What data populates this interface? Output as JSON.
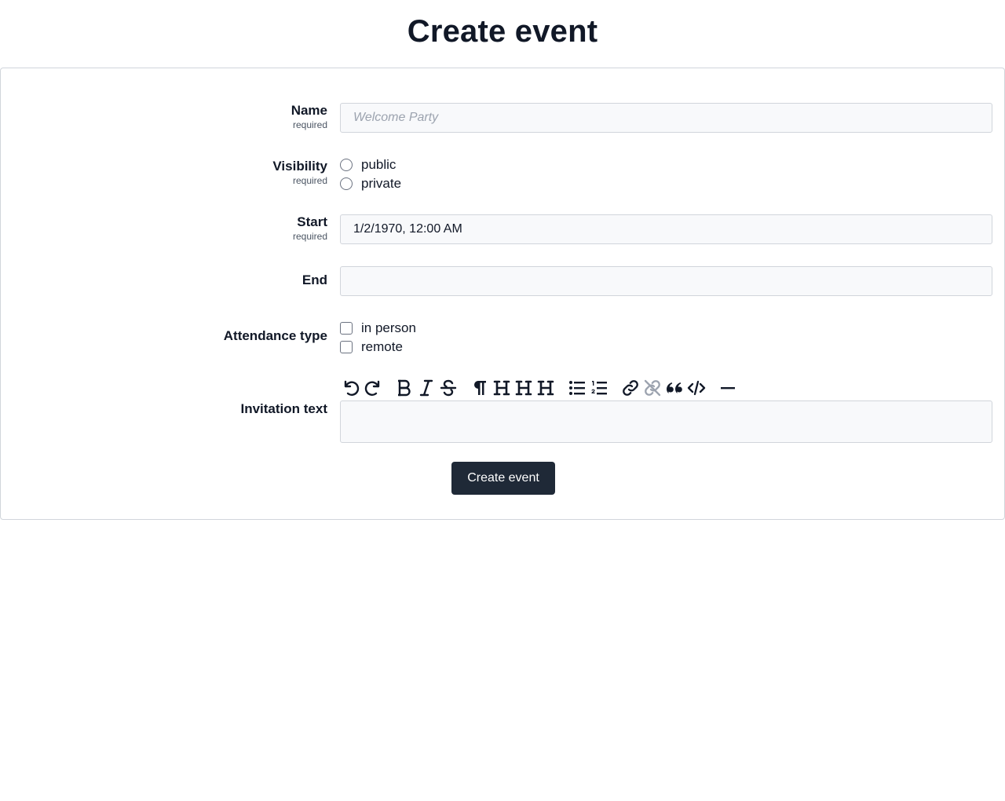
{
  "page": {
    "title": "Create event"
  },
  "form": {
    "name": {
      "label": "Name",
      "required_text": "required",
      "placeholder": "Welcome Party",
      "value": ""
    },
    "visibility": {
      "label": "Visibility",
      "required_text": "required",
      "options": [
        "public",
        "private"
      ]
    },
    "start": {
      "label": "Start",
      "required_text": "required",
      "value": "1/2/1970, 12:00 AM"
    },
    "end": {
      "label": "End",
      "value": ""
    },
    "attendance": {
      "label": "Attendance type",
      "options": [
        "in person",
        "remote"
      ]
    },
    "invitation": {
      "label": "Invitation text",
      "toolbar": [
        "undo-icon",
        "redo-icon",
        "bold-icon",
        "italic-icon",
        "strikethrough-icon",
        "paragraph-icon",
        "heading-1-icon",
        "heading-2-icon",
        "heading-3-icon",
        "bullet-list-icon",
        "ordered-list-icon",
        "link-icon",
        "unlink-icon",
        "blockquote-icon",
        "code-icon",
        "horizontal-rule-icon"
      ]
    },
    "submit_label": "Create event"
  },
  "colors": {
    "primary": "#1f2937",
    "input_bg": "#f8f9fb",
    "border": "#d1d5db",
    "text": "#111827"
  }
}
